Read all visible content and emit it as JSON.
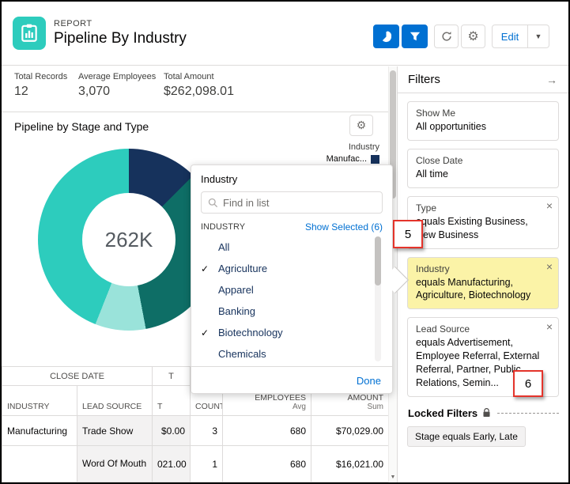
{
  "header": {
    "eyebrow": "REPORT",
    "title": "Pipeline By Industry",
    "edit_label": "Edit"
  },
  "icons": {
    "gear": "⚙",
    "arrow_right": "→",
    "caret_down": "▼",
    "close": "×",
    "scroll_down": "▼"
  },
  "stats": [
    {
      "label": "Total Records",
      "value": "12"
    },
    {
      "label": "Average Employees",
      "value": "3,070"
    },
    {
      "label": "Total Amount",
      "value": "$262,098.01"
    }
  ],
  "chart": {
    "title": "Pipeline by Stage and Type",
    "center_label": "262K",
    "legend_group": "Industry",
    "legend_item": "Manufac...",
    "donut": {
      "segments": [
        {
          "name": "dark-navy",
          "color": "#16325C",
          "percent": 12.5
        },
        {
          "name": "dark-teal",
          "color": "#0E6E66",
          "percent": 34.5
        },
        {
          "name": "light-aqua",
          "color": "#9AE3DA",
          "percent": 9
        },
        {
          "name": "teal",
          "color": "#2DCCBD",
          "percent": 44
        }
      ]
    }
  },
  "chart_data": {
    "type": "pie",
    "title": "Pipeline by Stage and Type",
    "center_total": "262K",
    "legend_title": "Industry",
    "legend_entries": [
      "Manufac..."
    ],
    "segments_percent": [
      12.5,
      34.5,
      9,
      44
    ]
  },
  "popup": {
    "title": "Industry",
    "search_placeholder": "Find in list",
    "list_header": "INDUSTRY",
    "show_selected": "Show Selected (6)",
    "items": [
      {
        "label": "All",
        "check": ""
      },
      {
        "label": "Agriculture",
        "check": "✓"
      },
      {
        "label": "Apparel",
        "check": ""
      },
      {
        "label": "Banking",
        "check": ""
      },
      {
        "label": "Biotechnology",
        "check": "✓"
      },
      {
        "label": "Chemicals",
        "check": ""
      }
    ],
    "done_label": "Done"
  },
  "table": {
    "group_header": {
      "close_date": "CLOSE DATE",
      "t": "T"
    },
    "columns": [
      {
        "label": "INDUSTRY",
        "sub": ""
      },
      {
        "label": "LEAD SOURCE",
        "sub": ""
      },
      {
        "label": "T",
        "sub": ""
      },
      {
        "label": "COUNT",
        "sub": ""
      },
      {
        "label": "EMPLOYEES",
        "sub": "Avg"
      },
      {
        "label": "AMOUNT",
        "sub": "Sum"
      }
    ],
    "rows": [
      {
        "industry": "Manufacturing",
        "lead_source": "Trade Show",
        "t": "$0.00",
        "count": "3",
        "employees": "680",
        "amount": "$70,029.00"
      },
      {
        "industry": "",
        "lead_source": "Word Of Mouth",
        "t": "021.00",
        "count": "1",
        "employees": "680",
        "amount": "$16,021.00"
      }
    ]
  },
  "filters": {
    "title": "Filters",
    "cards": [
      {
        "label": "Show Me",
        "value": "All opportunities",
        "removable": false,
        "highlighted": false
      },
      {
        "label": "Close Date",
        "value": "All time",
        "removable": false,
        "highlighted": false
      },
      {
        "label": "Type",
        "value": "equals Existing Business, New Business",
        "removable": true,
        "highlighted": false
      },
      {
        "label": "Industry",
        "value": "equals Manufacturing, Agriculture, Biotechnology",
        "removable": true,
        "highlighted": true
      },
      {
        "label": "Lead Source",
        "value": "equals Advertisement, Employee Referral, External Referral, Partner, Public Relations, Semin...",
        "removable": true,
        "highlighted": false
      }
    ],
    "locked_title": "Locked Filters",
    "locked_pill": "Stage equals Early, Late"
  },
  "annotations": {
    "box5": "5",
    "box6": "6"
  }
}
